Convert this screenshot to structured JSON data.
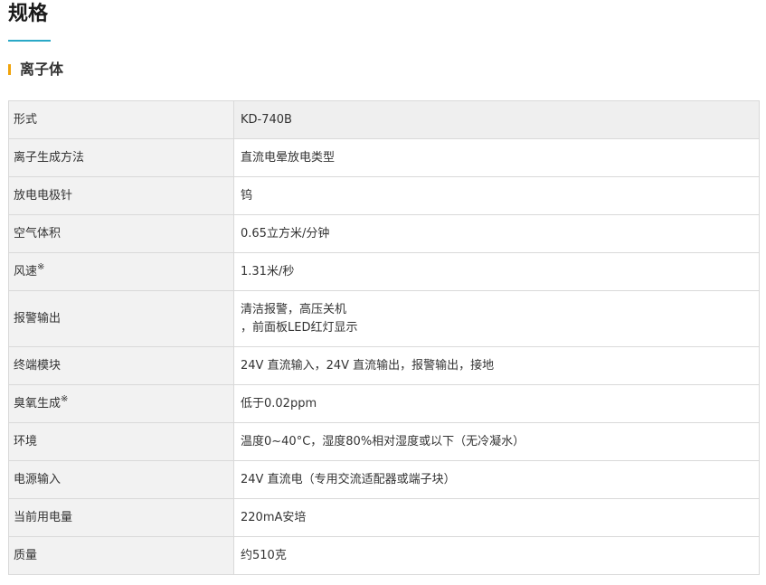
{
  "page_title": "规格",
  "section_title": "离子体",
  "note_mark": "※",
  "rows": [
    {
      "label": "形式",
      "note": false,
      "value": [
        "KD-740B"
      ]
    },
    {
      "label": "离子生成方法",
      "note": false,
      "value": [
        "直流电晕放电类型"
      ]
    },
    {
      "label": "放电电极针",
      "note": false,
      "value": [
        "钨"
      ]
    },
    {
      "label": "空气体积",
      "note": false,
      "value": [
        "0.65立方米/分钟"
      ]
    },
    {
      "label": "风速",
      "note": true,
      "value": [
        "1.31米/秒"
      ]
    },
    {
      "label": "报警输出",
      "note": false,
      "value": [
        "清洁报警，高压关机",
        "，前面板LED红灯显示"
      ]
    },
    {
      "label": "终端模块",
      "note": false,
      "value": [
        "24V 直流输入，24V 直流输出，报警输出，接地"
      ]
    },
    {
      "label": "臭氧生成",
      "note": true,
      "value": [
        "低于0.02ppm"
      ]
    },
    {
      "label": "环境",
      "note": false,
      "value": [
        "温度0~40°C，湿度80%相对湿度或以下（无冷凝水）"
      ]
    },
    {
      "label": "电源输入",
      "note": false,
      "value": [
        "24V 直流电（专用交流适配器或端子块）"
      ]
    },
    {
      "label": "当前用电量",
      "note": false,
      "value": [
        "220mA安培"
      ]
    },
    {
      "label": "质量",
      "note": false,
      "value": [
        "约510克"
      ]
    }
  ]
}
